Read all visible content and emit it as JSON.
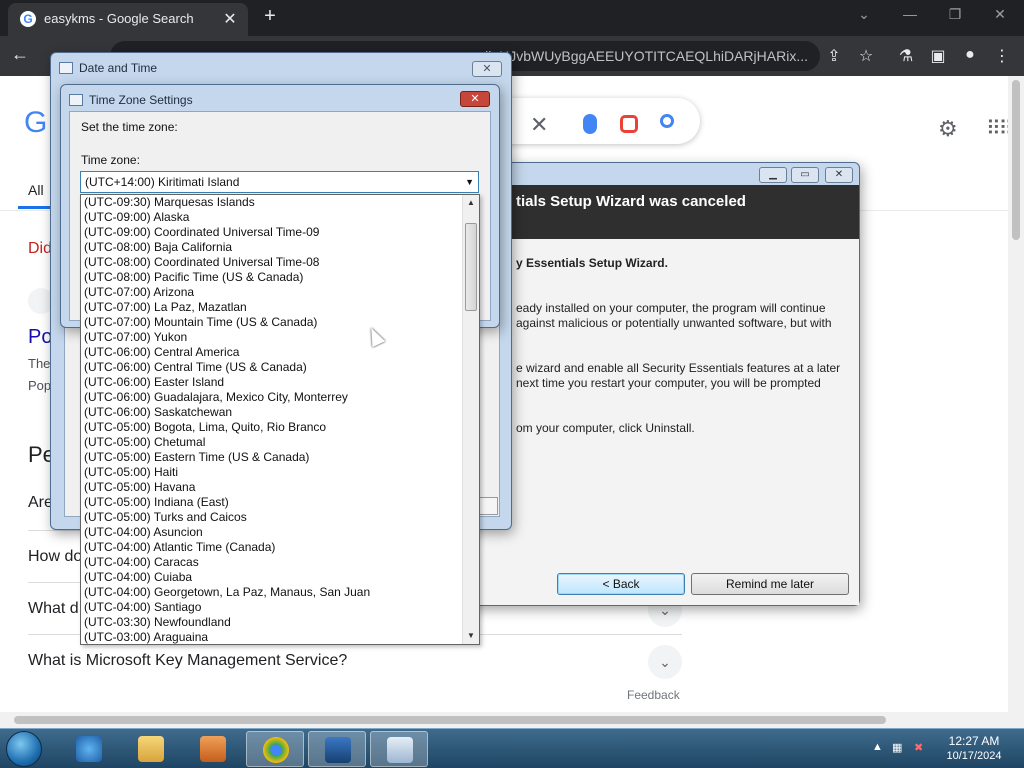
{
  "browser": {
    "tab_title": "easykms - Google Search",
    "favicon": "G",
    "url_fragment": "ljaHJvbWUyBggAEEUYOTITCAEQLhiDARjHARix..."
  },
  "google": {
    "logo_fragment": "G",
    "nav_all": "All",
    "fragments": {
      "did": "Did",
      "po": "Po",
      "the": "The",
      "pop": "Pop",
      "pe": "Pe",
      "are": "Are"
    },
    "faq": [
      {
        "question": "How do"
      },
      {
        "question": "What d"
      },
      {
        "question": "What is Microsoft Key Management Service?"
      }
    ],
    "feedback": "Feedback"
  },
  "wizard": {
    "header_title": "tials Setup Wizard was canceled",
    "line1": "y Essentials Setup Wizard.",
    "para1_l1": "eady installed on your computer, the program will continue",
    "para1_l2": "against malicious or potentially unwanted software, but with",
    "para2_l1": "e wizard and enable all Security Essentials features at a later",
    "para2_l2": "next time you restart your computer, you will be prompted",
    "para3": "om your computer, click Uninstall.",
    "back_label": "< Back",
    "remind_label": "Remind me later"
  },
  "datetime_window": {
    "title": "Date and Time"
  },
  "tz_window": {
    "title": "Time Zone Settings",
    "prompt": "Set the time zone:",
    "label": "Time zone:",
    "selected": "(UTC+14:00) Kiritimati Island"
  },
  "tz_options": [
    "(UTC-09:30) Marquesas Islands",
    "(UTC-09:00) Alaska",
    "(UTC-09:00) Coordinated Universal Time-09",
    "(UTC-08:00) Baja California",
    "(UTC-08:00) Coordinated Universal Time-08",
    "(UTC-08:00) Pacific Time (US & Canada)",
    "(UTC-07:00) Arizona",
    "(UTC-07:00) La Paz, Mazatlan",
    "(UTC-07:00) Mountain Time (US & Canada)",
    "(UTC-07:00) Yukon",
    "(UTC-06:00) Central America",
    "(UTC-06:00) Central Time (US & Canada)",
    "(UTC-06:00) Easter Island",
    "(UTC-06:00) Guadalajara, Mexico City, Monterrey",
    "(UTC-06:00) Saskatchewan",
    "(UTC-05:00) Bogota, Lima, Quito, Rio Branco",
    "(UTC-05:00) Chetumal",
    "(UTC-05:00) Eastern Time (US & Canada)",
    "(UTC-05:00) Haiti",
    "(UTC-05:00) Havana",
    "(UTC-05:00) Indiana (East)",
    "(UTC-05:00) Turks and Caicos",
    "(UTC-04:00) Asuncion",
    "(UTC-04:00) Atlantic Time (Canada)",
    "(UTC-04:00) Caracas",
    "(UTC-04:00) Cuiaba",
    "(UTC-04:00) Georgetown, La Paz, Manaus, San Juan",
    "(UTC-04:00) Santiago",
    "(UTC-03:30) Newfoundland",
    "(UTC-03:00) Araguaina"
  ],
  "taskbar": {
    "time": "12:27 AM",
    "date": "10/17/2024"
  }
}
